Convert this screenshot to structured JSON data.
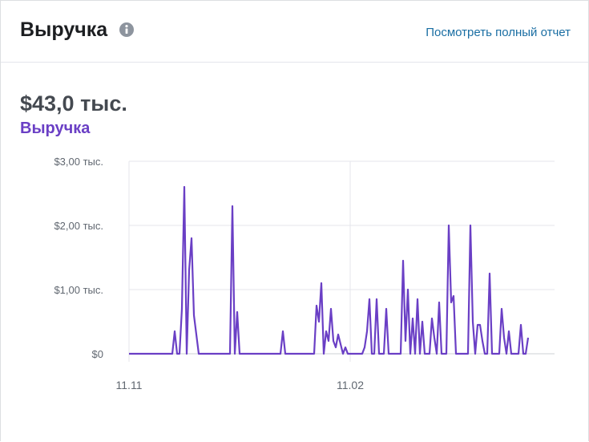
{
  "header": {
    "title": "Выручка",
    "info_icon": "info-icon",
    "report_link": "Посмотреть полный отчет"
  },
  "summary": {
    "total": "$43,0 тыс.",
    "series_label": "Выручка"
  },
  "colors": {
    "line": "#6a3fc5",
    "grid": "#e4e6eb",
    "link": "#1a6ea3"
  },
  "chart_data": {
    "type": "line",
    "title": "",
    "xlabel": "",
    "ylabel": "",
    "ylim": [
      0,
      3000
    ],
    "y_ticks": [
      {
        "value": 0,
        "label": "$0"
      },
      {
        "value": 1000,
        "label": "$1,00 тыс."
      },
      {
        "value": 2000,
        "label": "$2,00 тыс."
      },
      {
        "value": 3000,
        "label": "$3,00 тыс."
      }
    ],
    "x_ticks": [
      {
        "index": 0,
        "label": "11.11"
      },
      {
        "index": 92,
        "label": "11.02"
      }
    ],
    "x_max_index": 177,
    "grid": true,
    "series": [
      {
        "name": "Выручка",
        "values": [
          0,
          0,
          0,
          0,
          0,
          0,
          0,
          0,
          0,
          0,
          0,
          0,
          0,
          0,
          0,
          0,
          0,
          0,
          0,
          350,
          0,
          0,
          700,
          2600,
          0,
          1300,
          1800,
          600,
          300,
          0,
          0,
          0,
          0,
          0,
          0,
          0,
          0,
          0,
          0,
          0,
          0,
          0,
          0,
          2300,
          0,
          650,
          0,
          0,
          0,
          0,
          0,
          0,
          0,
          0,
          0,
          0,
          0,
          0,
          0,
          0,
          0,
          0,
          0,
          0,
          350,
          0,
          0,
          0,
          0,
          0,
          0,
          0,
          0,
          0,
          0,
          0,
          0,
          0,
          750,
          500,
          1100,
          0,
          350,
          200,
          700,
          200,
          100,
          300,
          150,
          0,
          100,
          0,
          0,
          0,
          0,
          0,
          0,
          0,
          100,
          350,
          850,
          0,
          0,
          850,
          0,
          0,
          0,
          700,
          0,
          0,
          0,
          0,
          0,
          0,
          1450,
          200,
          1000,
          0,
          550,
          0,
          850,
          0,
          500,
          0,
          0,
          0,
          550,
          250,
          0,
          800,
          0,
          0,
          0,
          2000,
          800,
          900,
          0,
          0,
          0,
          0,
          0,
          0,
          2000,
          500,
          0,
          450,
          450,
          200,
          0,
          0,
          1250,
          0,
          0,
          0,
          0,
          700,
          250,
          0,
          350,
          0,
          0,
          0,
          0,
          450,
          0,
          0,
          250
        ]
      }
    ]
  }
}
